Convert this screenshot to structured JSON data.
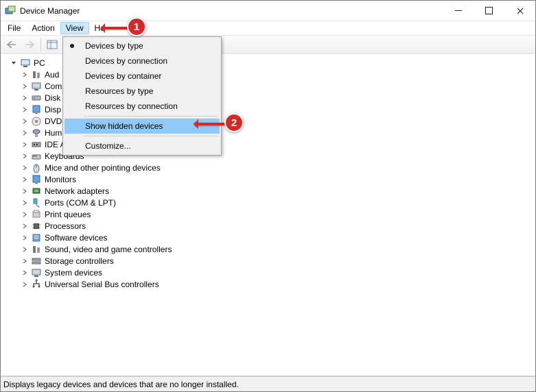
{
  "window": {
    "title": "Device Manager"
  },
  "menubar": {
    "items": [
      "File",
      "Action",
      "View",
      "He"
    ]
  },
  "dropdown": {
    "items": [
      {
        "label": "Devices by type",
        "checked": true
      },
      {
        "label": "Devices by connection"
      },
      {
        "label": "Devices by container"
      },
      {
        "label": "Resources by type"
      },
      {
        "label": "Resources by connection"
      },
      {
        "sep": true
      },
      {
        "label": "Show hidden devices",
        "highlight": true
      },
      {
        "sep": true
      },
      {
        "label": "Customize..."
      }
    ]
  },
  "tree": {
    "root": "PC",
    "items": [
      "Aud",
      "Com",
      "Disk",
      "Disp",
      "DVD",
      "Hum",
      "IDE A",
      "Keyboards",
      "Mice and other pointing devices",
      "Monitors",
      "Network adapters",
      "Ports (COM & LPT)",
      "Print queues",
      "Processors",
      "Software devices",
      "Sound, video and game controllers",
      "Storage controllers",
      "System devices",
      "Universal Serial Bus controllers"
    ]
  },
  "statusbar": {
    "text": "Displays legacy devices and devices that are no longer installed."
  },
  "annotations": {
    "one": "1",
    "two": "2"
  }
}
